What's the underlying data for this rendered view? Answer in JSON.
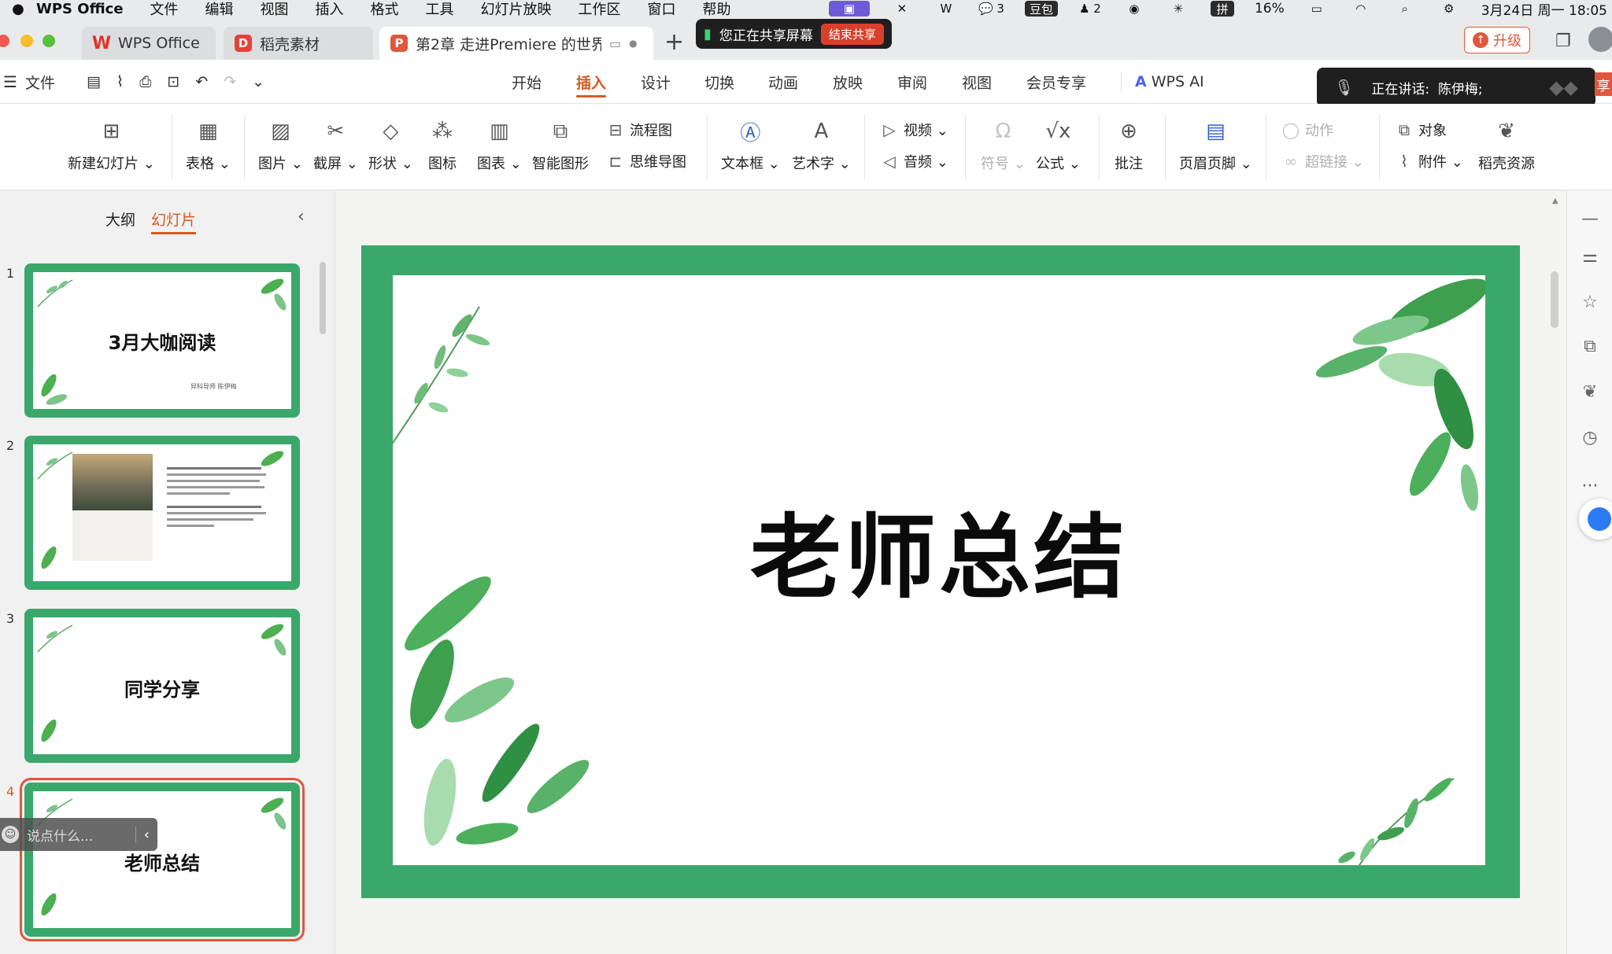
{
  "menubar": {
    "app_name": "WPS Office",
    "items": [
      "文件",
      "编辑",
      "视图",
      "插入",
      "格式",
      "工具",
      "幻灯片放映",
      "工作区",
      "窗口",
      "帮助"
    ],
    "status": {
      "wechat_count": "3",
      "doubao": "豆包",
      "qq_count": "2",
      "ime": "拼",
      "battery": "16%",
      "datetime": "3月24日 周一 18:05"
    }
  },
  "tabs": [
    {
      "label": "WPS Office",
      "logo": "W"
    },
    {
      "label": "稻壳素材",
      "logo": "D"
    },
    {
      "label": "第2章  走进Premiere 的世界",
      "logo": "P"
    }
  ],
  "share": {
    "label": "您正在共享屏幕",
    "stop": "结束共享"
  },
  "upgrade": "升级",
  "file_menu": "文件",
  "ribbon_tabs": [
    "开始",
    "插入",
    "设计",
    "切换",
    "动画",
    "放映",
    "审阅",
    "视图",
    "会员专享",
    "WPS AI"
  ],
  "active_ribbon_tab": "插入",
  "speaking": {
    "label": "正在讲话:",
    "name": "陈伊梅;"
  },
  "share_edge": "享",
  "tools": {
    "new_slide": "新建幻灯片",
    "table": "表格",
    "picture": "图片",
    "screenshot": "截屏",
    "shape": "形状",
    "icon": "图标",
    "chart": "图表",
    "smartart": "智能图形",
    "flowchart": "流程图",
    "mindmap": "思维导图",
    "textbox": "文本框",
    "wordart": "艺术字",
    "video": "视频",
    "audio": "音频",
    "symbol": "符号",
    "formula": "公式",
    "comment": "批注",
    "header_footer": "页眉页脚",
    "action": "动作",
    "hyperlink": "超链接",
    "object": "对象",
    "attachment": "附件",
    "docer": "稻壳资源"
  },
  "panel": {
    "outline": "大纲",
    "slides": "幻灯片",
    "thumbnails": [
      {
        "num": "1",
        "title": "3月大咖阅读",
        "sub": "异科导师  陈伊梅"
      },
      {
        "num": "2",
        "title": ""
      },
      {
        "num": "3",
        "title": "同学分享"
      },
      {
        "num": "4",
        "title": "老师总结"
      }
    ]
  },
  "chat_placeholder": "说点什么...",
  "slide": {
    "title": "老师总结"
  },
  "colors": {
    "accent": "#d65a1f",
    "slide_green": "#3aa86b",
    "leaf_green": "#4caf50"
  }
}
